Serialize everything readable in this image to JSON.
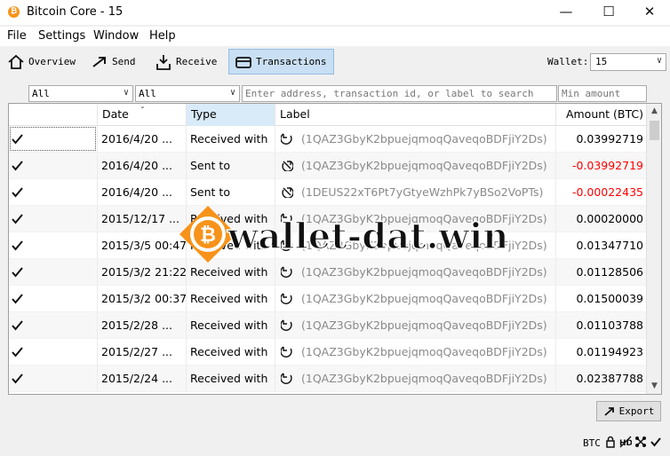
{
  "window": {
    "title": "Bitcoin Core - 15",
    "minimize": "—",
    "maximize": "☐",
    "close": "✕"
  },
  "menu": [
    "File",
    "Settings",
    "Window",
    "Help"
  ],
  "toolbar": {
    "overview": "Overview",
    "send": "Send",
    "receive": "Receive",
    "transactions": "Transactions",
    "wallet_label": "Wallet:",
    "wallet_value": "15"
  },
  "filters": {
    "date": "All",
    "type": "All",
    "search_placeholder": "Enter address, transaction id, or label to search",
    "min_amount_placeholder": "Min amount"
  },
  "table": {
    "headers": {
      "date": "Date",
      "type": "Type",
      "label": "Label",
      "amount": "Amount (BTC)"
    },
    "rows": [
      {
        "date": "2016/4/20 ...",
        "type": "Received with",
        "label": "(1QAZ3GbyK2bpuejqmoqQaveqoBDFjiY2Ds)",
        "amount": "0.03992719",
        "negative": false
      },
      {
        "date": "2016/4/20 ...",
        "type": "Sent to",
        "label": "(1QAZ3GbyK2bpuejqmoqQaveqoBDFjiY2Ds)",
        "amount": "-0.03992719",
        "negative": true
      },
      {
        "date": "2016/4/20 ...",
        "type": "Sent to",
        "label": "(1DEUS22xT6Pt7yGtyeWzhPk7yBSo2VoPTs)",
        "amount": "-0.00022435",
        "negative": true
      },
      {
        "date": "2015/12/17 ...",
        "type": "Received with",
        "label": "(1QAZ3GbyK2bpuejqmoqQaveqoBDFjiY2Ds)",
        "amount": "0.00020000",
        "negative": false
      },
      {
        "date": "2015/3/5 00:47",
        "type": "Received with",
        "label": "(1QAZ3GbyK2bpuejqmoqQaveqoBDFjiY2Ds)",
        "amount": "0.01347710",
        "negative": false
      },
      {
        "date": "2015/3/2 21:22",
        "type": "Received with",
        "label": "(1QAZ3GbyK2bpuejqmoqQaveqoBDFjiY2Ds)",
        "amount": "0.01128506",
        "negative": false
      },
      {
        "date": "2015/3/2 00:37",
        "type": "Received with",
        "label": "(1QAZ3GbyK2bpuejqmoqQaveqoBDFjiY2Ds)",
        "amount": "0.01500039",
        "negative": false
      },
      {
        "date": "2015/2/28 ...",
        "type": "Received with",
        "label": "(1QAZ3GbyK2bpuejqmoqQaveqoBDFjiY2Ds)",
        "amount": "0.01103788",
        "negative": false
      },
      {
        "date": "2015/2/27 ...",
        "type": "Received with",
        "label": "(1QAZ3GbyK2bpuejqmoqQaveqoBDFjiY2Ds)",
        "amount": "0.01194923",
        "negative": false
      },
      {
        "date": "2015/2/24 ...",
        "type": "Received with",
        "label": "(1QAZ3GbyK2bpuejqmoqQaveqoBDFjiY2Ds)",
        "amount": "0.02387788",
        "negative": false
      }
    ]
  },
  "watermark": "wallet-dat.win",
  "export_label": "Export",
  "status_unit": "BTC",
  "colors": {
    "negative": "#ff0000",
    "active_tab": "#c9dff3",
    "bitcoin_orange": "#f7931a"
  }
}
